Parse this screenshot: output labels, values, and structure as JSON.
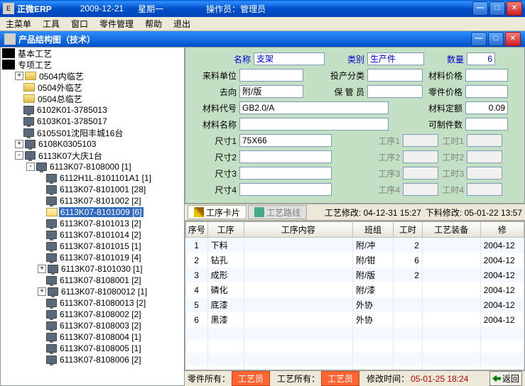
{
  "titlebar": {
    "app": "正微ERP",
    "date": "2009-12-21",
    "weekday": "星期一",
    "operator_label": "操作员：",
    "operator": "管理员"
  },
  "menubar": [
    "主菜单",
    "工具",
    "窗口",
    "零件管理",
    "帮助",
    "退出"
  ],
  "subtitle": "产品结构图（技术）",
  "tree": {
    "root1": "基本工艺",
    "root2": "专项工艺",
    "nodes": [
      {
        "indent": 1,
        "toggle": "+",
        "icon": "folder",
        "label": "0504内临艺"
      },
      {
        "indent": 1,
        "toggle": "",
        "icon": "folder",
        "label": "0504外临艺"
      },
      {
        "indent": 1,
        "toggle": "",
        "icon": "folder",
        "label": "0504总临艺"
      },
      {
        "indent": 1,
        "toggle": "",
        "icon": "monitor",
        "label": "6102K01-3785013"
      },
      {
        "indent": 1,
        "toggle": "",
        "icon": "monitor",
        "label": "6103K01-3785017"
      },
      {
        "indent": 1,
        "toggle": "",
        "icon": "monitor",
        "label": "6105S01沈阳丰城16台"
      },
      {
        "indent": 1,
        "toggle": "+",
        "icon": "monitor",
        "label": "6108K0305103"
      },
      {
        "indent": 1,
        "toggle": "-",
        "icon": "monitor",
        "label": "6113K07大庆1台"
      },
      {
        "indent": 2,
        "toggle": "-",
        "icon": "monitor",
        "label": "6113K07-8108000  [1]"
      },
      {
        "indent": 3,
        "toggle": "",
        "icon": "monitor",
        "label": "6112H1L-8101101A1  [1]"
      },
      {
        "indent": 3,
        "toggle": "",
        "icon": "monitor",
        "label": "6113K07-8101001  [28]"
      },
      {
        "indent": 3,
        "toggle": "",
        "icon": "monitor",
        "label": "6113K07-8101002  [2]"
      },
      {
        "indent": 3,
        "toggle": "",
        "icon": "folder-open",
        "label": "6113K07-8101009  [6]",
        "selected": true
      },
      {
        "indent": 3,
        "toggle": "",
        "icon": "monitor",
        "label": "6113K07-8101013  [2]"
      },
      {
        "indent": 3,
        "toggle": "",
        "icon": "monitor",
        "label": "6113K07-8101014  [2]"
      },
      {
        "indent": 3,
        "toggle": "",
        "icon": "monitor",
        "label": "6113K07-8101015  [1]"
      },
      {
        "indent": 3,
        "toggle": "",
        "icon": "monitor",
        "label": "6113K07-8101019  [4]"
      },
      {
        "indent": 3,
        "toggle": "+",
        "icon": "monitor",
        "label": "6113K07-8101030  [1]"
      },
      {
        "indent": 3,
        "toggle": "",
        "icon": "monitor",
        "label": "6113K07-8108001  [2]"
      },
      {
        "indent": 3,
        "toggle": "+",
        "icon": "monitor",
        "label": "6113K07-81080012  [1]"
      },
      {
        "indent": 3,
        "toggle": "",
        "icon": "monitor",
        "label": "6113K07-81080013  [2]"
      },
      {
        "indent": 3,
        "toggle": "",
        "icon": "monitor",
        "label": "6113K07-8108002  [2]"
      },
      {
        "indent": 3,
        "toggle": "",
        "icon": "monitor",
        "label": "6113K07-8108003  [2]"
      },
      {
        "indent": 3,
        "toggle": "",
        "icon": "monitor",
        "label": "6113K07-8108004  [1]"
      },
      {
        "indent": 3,
        "toggle": "",
        "icon": "monitor",
        "label": "6113K07-8108005  [1]"
      },
      {
        "indent": 3,
        "toggle": "",
        "icon": "monitor",
        "label": "6113K07-8108006  [2]"
      }
    ]
  },
  "form": {
    "row1": {
      "l1": "名称",
      "v1": "支架",
      "l2": "类别",
      "v2": "生产件",
      "l3": "数量",
      "v3": "6"
    },
    "row2": {
      "l1": "来料单位",
      "l2": "投产分类",
      "l3": "材料价格"
    },
    "row3": {
      "l1": "去向",
      "v1": "附/版",
      "l2": "保 管 员",
      "l3": "零件价格"
    },
    "row4": {
      "l1": "材料代号",
      "v1": "GB2.0/A",
      "l2": "材料定额",
      "v2": "0.09"
    },
    "row5": {
      "l1": "材料名称",
      "l2": "可制件数"
    },
    "row6": {
      "l1": "尺寸1",
      "v1": "75X66",
      "l2": "工序1",
      "l3": "工时1"
    },
    "row7": {
      "l1": "尺寸2",
      "l2": "工序2",
      "l3": "工时2"
    },
    "row8": {
      "l1": "尺寸3",
      "l2": "工序3",
      "l3": "工时3"
    },
    "row9": {
      "l1": "尺寸4",
      "l2": "工序4",
      "l3": "工时4"
    }
  },
  "tabs": {
    "t1": "工序卡片",
    "t2": "工艺路线",
    "info1_label": "工艺修改:",
    "info1_value": "04-12-31 15:27",
    "info2_label": "下料修改:",
    "info2_value": "05-01-22 13:57"
  },
  "grid": {
    "headers": [
      "序号",
      "工序",
      "工序内容",
      "班组",
      "工时",
      "工艺装备",
      "修"
    ],
    "rows": [
      {
        "n": "1",
        "p": "下料",
        "c": "",
        "g": "附/冲",
        "h": "2",
        "e": "",
        "m": "2004-12"
      },
      {
        "n": "2",
        "p": "钻孔",
        "c": "",
        "g": "附/钳",
        "h": "6",
        "e": "",
        "m": "2004-12"
      },
      {
        "n": "3",
        "p": "成形",
        "c": "",
        "g": "附/版",
        "h": "2",
        "e": "",
        "m": "2004-12"
      },
      {
        "n": "4",
        "p": "磷化",
        "c": "",
        "g": "附/漆",
        "h": "",
        "e": "",
        "m": "2004-12"
      },
      {
        "n": "5",
        "p": "底漆",
        "c": "",
        "g": "外协",
        "h": "",
        "e": "",
        "m": "2004-12"
      },
      {
        "n": "6",
        "p": "黑漆",
        "c": "",
        "g": "外协",
        "h": "",
        "e": "",
        "m": "2004-12"
      }
    ]
  },
  "statusbar": {
    "l1": "零件所有：",
    "b1": "工艺员",
    "l2": "工艺所有：",
    "b2": "工艺员",
    "l3": "修改时间：",
    "v3": "05-01-25 18:24",
    "return": "返回"
  }
}
